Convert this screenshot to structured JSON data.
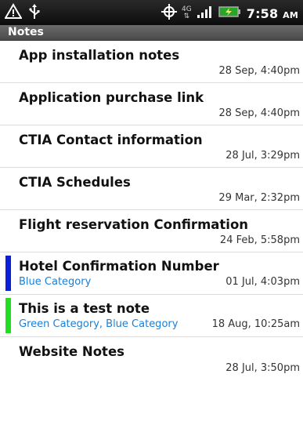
{
  "status_bar": {
    "left_icons": [
      "warning-icon",
      "usb-icon"
    ],
    "right_icons": [
      "gps-icon",
      "network-4g-icon",
      "signal-icon",
      "battery-charging-icon"
    ],
    "network_label": "4G",
    "time": "7:58",
    "ampm": "AM"
  },
  "app": {
    "title": "Notes"
  },
  "notes": [
    {
      "title": "App installation notes",
      "date": "28 Sep, 4:40pm",
      "category": "",
      "category_color": ""
    },
    {
      "title": "Application purchase link",
      "date": "28 Sep, 4:40pm",
      "category": "",
      "category_color": ""
    },
    {
      "title": "CTIA Contact information",
      "date": "28 Jul, 3:29pm",
      "category": "",
      "category_color": ""
    },
    {
      "title": "CTIA Schedules",
      "date": "29 Mar, 2:32pm",
      "category": "",
      "category_color": ""
    },
    {
      "title": "Flight reservation Confirmation",
      "date": "24 Feb, 5:58pm",
      "category": "",
      "category_color": ""
    },
    {
      "title": "Hotel Confirmation Number",
      "date": "01 Jul, 4:03pm",
      "category": "Blue Category",
      "category_color": "#0a1fd8"
    },
    {
      "title": "This is a test note",
      "date": "18 Aug, 10:25am",
      "category": "Green Category, Blue Category",
      "category_color": "#22dd22"
    },
    {
      "title": "Website Notes",
      "date": "28 Jul, 3:50pm",
      "category": "",
      "category_color": ""
    }
  ],
  "colors": {
    "category_text": "#1a7fd6",
    "divider": "#dcdcdc"
  }
}
